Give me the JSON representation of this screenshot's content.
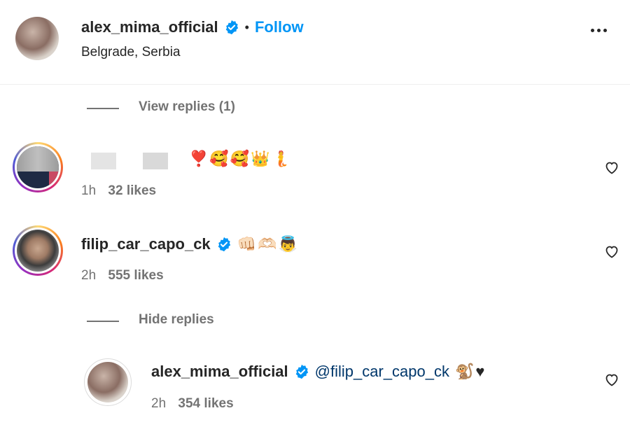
{
  "header": {
    "username": "alex_mima_official",
    "separator": "•",
    "follow_label": "Follow",
    "location": "Belgrade, Serbia",
    "more_label": "•••"
  },
  "view_replies": "View replies (1)",
  "comments": [
    {
      "username": "",
      "text": "❣️🥰🥰👑🧜",
      "time": "1h",
      "likes": "32 likes"
    },
    {
      "username": "filip_car_capo_ck",
      "text": "👊🏻🫶🏻👼",
      "time": "2h",
      "likes": "555 likes"
    }
  ],
  "hide_replies": "Hide replies",
  "reply": {
    "username": "alex_mima_official",
    "mention": "@filip_car_capo_ck",
    "text": "🐒♥",
    "time": "2h",
    "likes": "354 likes"
  },
  "colors": {
    "link": "#0095f6",
    "verified": "#0095f6",
    "muted": "#737373"
  }
}
